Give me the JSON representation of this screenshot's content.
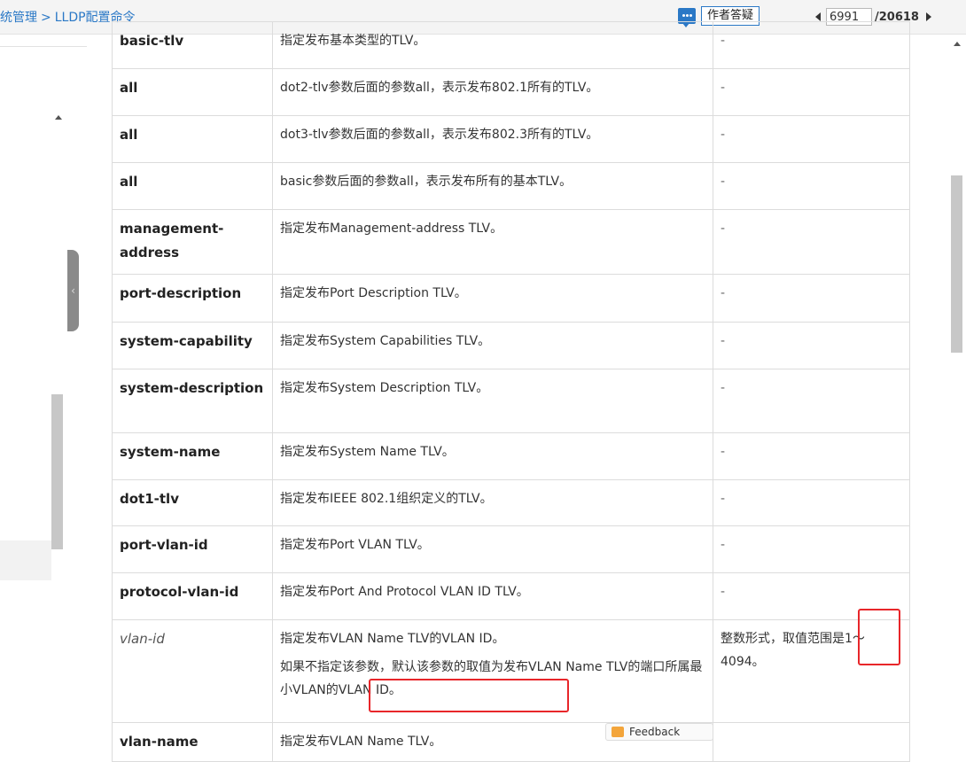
{
  "header": {
    "breadcrumb_prefix": "统管理",
    "breadcrumb_separator": ">",
    "breadcrumb_current": "LLDP配置命令",
    "qa_button_label": "作者答疑",
    "page_current": "6991",
    "page_total": "/20618"
  },
  "table": {
    "rows": [
      {
        "param": "basic-tlv",
        "desc": "指定发布基本类型的TLV。",
        "value": "-"
      },
      {
        "param": "all",
        "desc": "dot2-tlv参数后面的参数all，表示发布802.1所有的TLV。",
        "value": "-"
      },
      {
        "param": "all",
        "desc": "dot3-tlv参数后面的参数all，表示发布802.3所有的TLV。",
        "value": "-"
      },
      {
        "param": "all",
        "desc": "basic参数后面的参数all，表示发布所有的基本TLV。",
        "value": "-"
      },
      {
        "param": "management-address",
        "desc": "指定发布Management-address TLV。",
        "value": "-"
      },
      {
        "param": "port-description",
        "desc": "指定发布Port Description TLV。",
        "value": "-"
      },
      {
        "param": "system-capability",
        "desc": "指定发布System Capabilities TLV。",
        "value": "-"
      },
      {
        "param": "system-description",
        "desc": "指定发布System Description TLV。",
        "value": "-"
      },
      {
        "param": "system-name",
        "desc": "指定发布System Name TLV。",
        "value": "-"
      },
      {
        "param": "dot1-tlv",
        "desc": "指定发布IEEE 802.1组织定义的TLV。",
        "value": "-"
      },
      {
        "param": "port-vlan-id",
        "desc": "指定发布Port VLAN TLV。",
        "value": "-"
      },
      {
        "param": "protocol-vlan-id",
        "desc": "指定发布Port And Protocol VLAN ID TLV。",
        "value": "-"
      }
    ],
    "vlan_row": {
      "param": "vlan-id",
      "desc1": "指定发布VLAN Name TLV的VLAN ID。",
      "desc2": "如果不指定该参数，默认该参数的取值为发布VLAN Name TLV的端口所属最小VLAN的VLAN ID。",
      "value": "整数形式，取值范围是1～4094。"
    },
    "partial_row": {
      "param": "vlan-name",
      "desc": "指定发布VLAN Name TLV。"
    }
  },
  "feedback_label": "Feedback",
  "colors": {
    "accent": "#2a78c6",
    "highlight": "#e8262a"
  }
}
